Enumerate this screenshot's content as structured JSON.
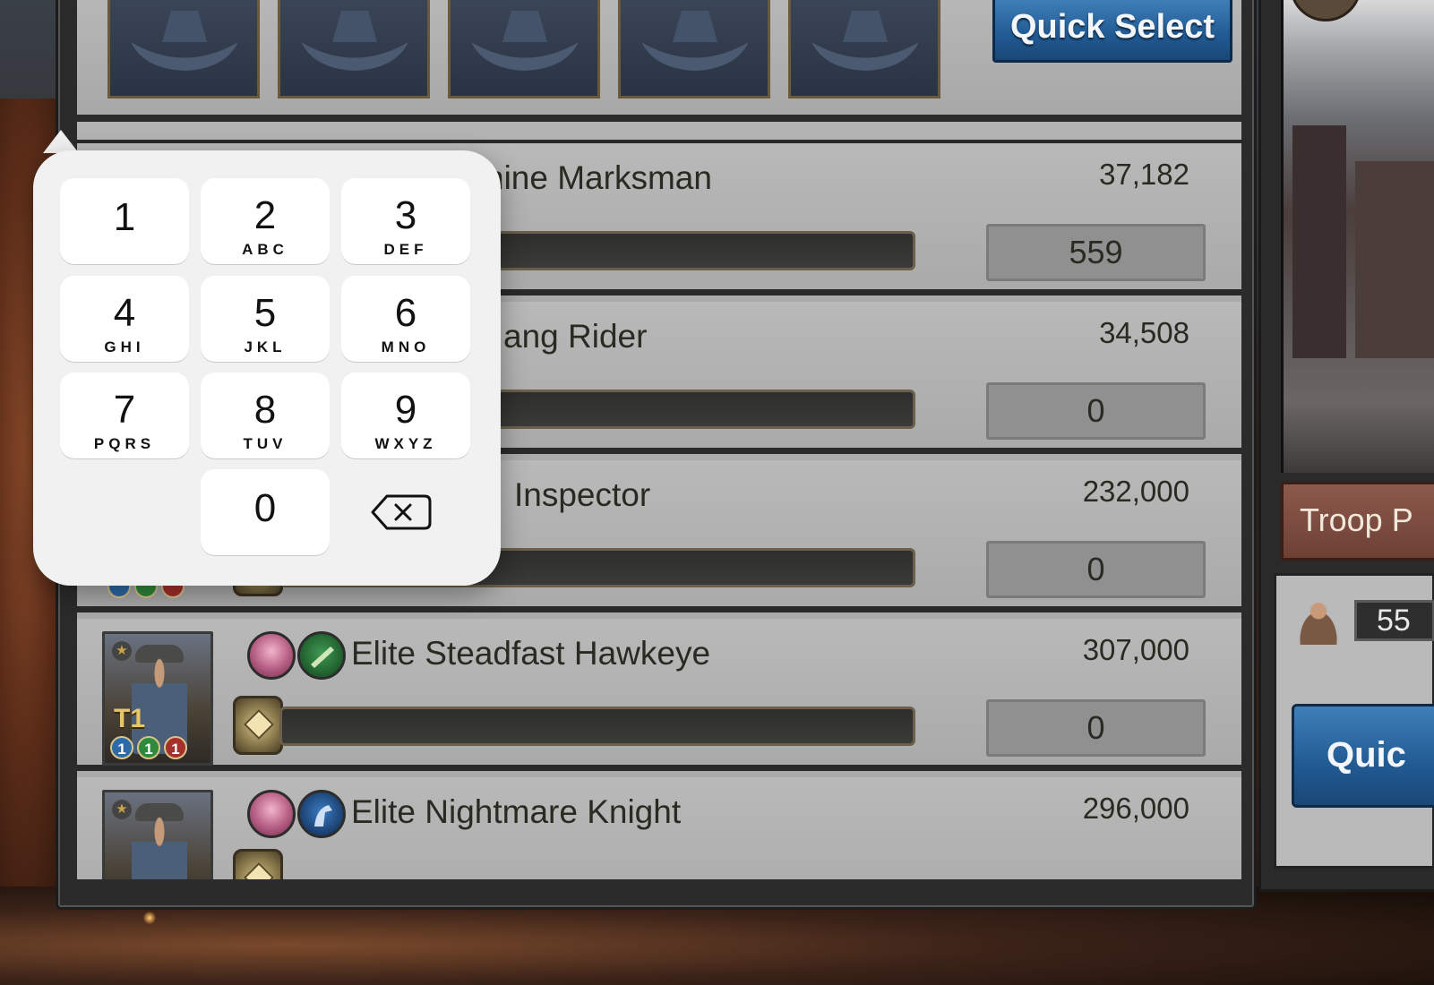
{
  "top_bar": {
    "quick_select_label": "Quick Select"
  },
  "troops": [
    {
      "name": "Elite Carmine Marksman",
      "name_visible": "nine Marksman",
      "power": "37,182",
      "count": "559",
      "icons": [
        "category-icon"
      ]
    },
    {
      "name_visible": "ang Rider",
      "power": "34,508",
      "count": "0"
    },
    {
      "name_visible": "Inspector",
      "power": "232,000",
      "count": "0"
    },
    {
      "name": "Elite Steadfast Hawkeye",
      "power": "307,000",
      "count": "0",
      "tier": "T1",
      "badges": [
        "1",
        "1",
        "1"
      ]
    },
    {
      "name": "Elite Nightmare Knight",
      "power": "296,000"
    }
  ],
  "right_panel": {
    "troop_button_label": "Troop P",
    "troop_count": "55",
    "quick_button_label": "Quic"
  },
  "keypad": {
    "keys": [
      {
        "digit": "1",
        "letters": ""
      },
      {
        "digit": "2",
        "letters": "ABC"
      },
      {
        "digit": "3",
        "letters": "DEF"
      },
      {
        "digit": "4",
        "letters": "GHI"
      },
      {
        "digit": "5",
        "letters": "JKL"
      },
      {
        "digit": "6",
        "letters": "MNO"
      },
      {
        "digit": "7",
        "letters": "PQRS"
      },
      {
        "digit": "8",
        "letters": "TUV"
      },
      {
        "digit": "9",
        "letters": "WXYZ"
      },
      {
        "digit": "0",
        "letters": ""
      }
    ],
    "delete_icon": "backspace-icon"
  },
  "colors": {
    "button_blue": "#215a93",
    "panel_gray": "#a9aaa9",
    "troop_button_brown": "#7a4a3c"
  }
}
